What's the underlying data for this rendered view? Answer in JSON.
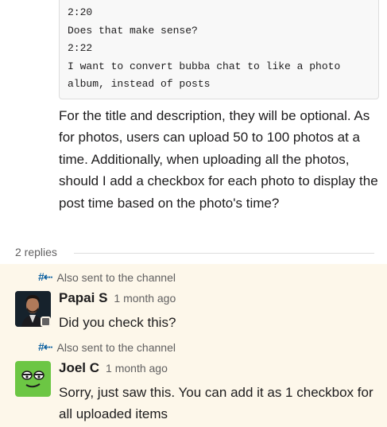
{
  "code_block": {
    "lines": [
      "2:20",
      "Does that make sense?",
      "2:22",
      "I want to convert bubba chat to like a photo",
      "album, instead of posts"
    ]
  },
  "message": {
    "text": "For the title and description, they will be optional. As for photos, users can upload 50 to 100 photos at a time. Additionally, when uploading all the photos, should I add a checkbox for each photo to display the post time based on the photo's time?"
  },
  "thread": {
    "replies_count": "2 replies"
  },
  "replies": [
    {
      "also_sent": "Also sent to the channel",
      "sender": "Papai S",
      "timestamp": "1 month ago",
      "text": "Did you check this?"
    },
    {
      "also_sent": "Also sent to the channel",
      "sender": "Joel C",
      "timestamp": "1 month ago",
      "text": "Sorry, just saw this. You can add it as 1 checkbox for all uploaded items"
    }
  ],
  "icons": {
    "also_sent": "hash-arrow-icon",
    "presence": "presence-away-icon"
  },
  "colors": {
    "reply_highlight": "#fdf7ea",
    "link_blue": "#1264a3",
    "muted_text": "#616061"
  }
}
